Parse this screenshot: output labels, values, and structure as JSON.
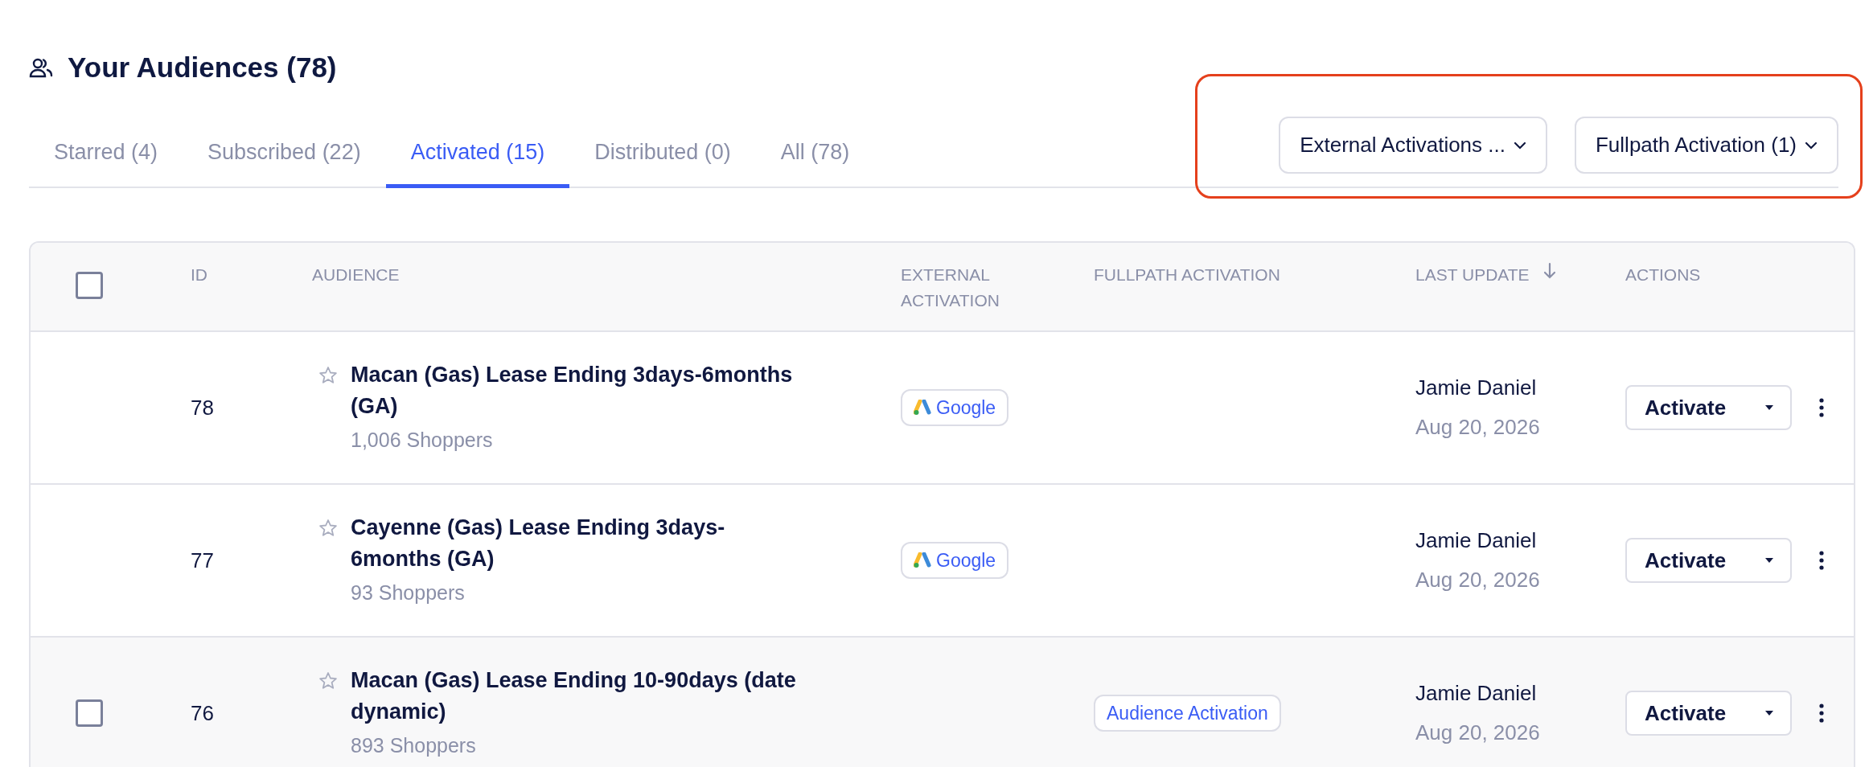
{
  "page": {
    "title": "Your Audiences (78)"
  },
  "tabs": [
    {
      "label": "Starred (4)",
      "selected": false
    },
    {
      "label": "Subscribed (22)",
      "selected": false
    },
    {
      "label": "Activated (15)",
      "selected": true
    },
    {
      "label": "Distributed (0)",
      "selected": false
    },
    {
      "label": "All (78)",
      "selected": false
    }
  ],
  "filters": [
    {
      "label": "External Activations ..."
    },
    {
      "label": "Fullpath Activation (1)"
    }
  ],
  "annotation_frame": true,
  "table": {
    "select_all_checked": false,
    "columns": [
      {
        "label": "ID",
        "sorted": false
      },
      {
        "label": "AUDIENCE",
        "sorted": false
      },
      {
        "label": "EXTERNAL ACTIVATION",
        "sorted": false
      },
      {
        "label": "FULLPATH ACTIVATION",
        "sorted": false
      },
      {
        "label": "LAST UPDATE",
        "sorted": true
      },
      {
        "label": "ACTIONS",
        "sorted": false
      }
    ],
    "rows": [
      {
        "hovered": false,
        "checked": false,
        "starred": false,
        "id": "78",
        "name": "Macan (Gas) Lease Ending 3days-6months (GA)",
        "count": "1,006 Shoppers",
        "external_activations": [
          {
            "label": "Google",
            "kind": "google"
          }
        ],
        "fullpath_activations": [],
        "updated_by": "Jamie Daniel",
        "updated_on": "Aug 20, 2026",
        "action": "Activate"
      },
      {
        "hovered": false,
        "checked": false,
        "starred": false,
        "id": "77",
        "name": "Cayenne (Gas) Lease Ending 3days-6months (GA)",
        "count": "93 Shoppers",
        "external_activations": [
          {
            "label": "Google",
            "kind": "google"
          }
        ],
        "fullpath_activations": [],
        "updated_by": "Jamie Daniel",
        "updated_on": "Aug 20, 2026",
        "action": "Activate"
      },
      {
        "hovered": true,
        "checked": false,
        "starred": false,
        "id": "76",
        "name": "Macan (Gas) Lease Ending 10-90days (date dynamic)",
        "count": "893 Shoppers",
        "external_activations": [],
        "fullpath_activations": [
          {
            "label": "Audience Activation"
          }
        ],
        "updated_by": "Jamie Daniel",
        "updated_on": "Aug 20, 2026",
        "action": "Activate"
      }
    ]
  }
}
